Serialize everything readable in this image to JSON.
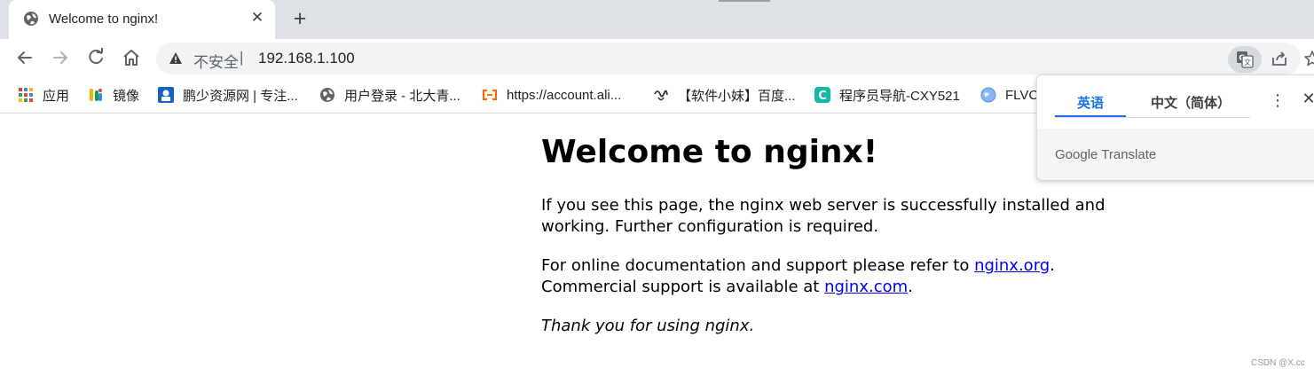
{
  "tab": {
    "title": "Welcome to nginx!",
    "close_glyph": "✕",
    "new_tab_glyph": "+"
  },
  "omnibox": {
    "security_label": "不安全",
    "separator": "|",
    "url": "192.168.1.100"
  },
  "bookmarks": [
    {
      "label": "应用",
      "icon": "apps-grid-icon"
    },
    {
      "label": "镜像",
      "icon": "mirror-icon"
    },
    {
      "label": "鹏少资源网 | 专注...",
      "icon": "site-icon"
    },
    {
      "label": "用户登录 - 北大青...",
      "icon": "globe-icon"
    },
    {
      "label": "https://account.ali...",
      "icon": "aliyun-icon"
    },
    {
      "label": "【软件小妹】百度...",
      "icon": "ruanjian-icon"
    },
    {
      "label": "程序员导航-CXY521",
      "icon": "c-icon"
    },
    {
      "label": "FLVC",
      "icon": "globe-icon"
    }
  ],
  "page": {
    "heading": "Welcome to nginx!",
    "para1": "If you see this page, the nginx web server is successfully installed and working. Further configuration is required.",
    "para2_prefix": "For online documentation and support please refer to ",
    "link_org": "nginx.org",
    "para2_mid": ".",
    "para2_line2": "Commercial support is available at ",
    "link_com": "nginx.com",
    "para2_end": ".",
    "para3": "Thank you for using nginx."
  },
  "translate_popup": {
    "source_lang": "英语",
    "target_lang": "中文（简体）",
    "menu_glyph": "⋮",
    "close_glyph": "✕",
    "brand": "Google Translate"
  },
  "watermark": "CSDN @X.cc",
  "colors": {
    "link": "#0000ee",
    "accent": "#1a73e8",
    "tabstrip": "#dee1e6"
  }
}
